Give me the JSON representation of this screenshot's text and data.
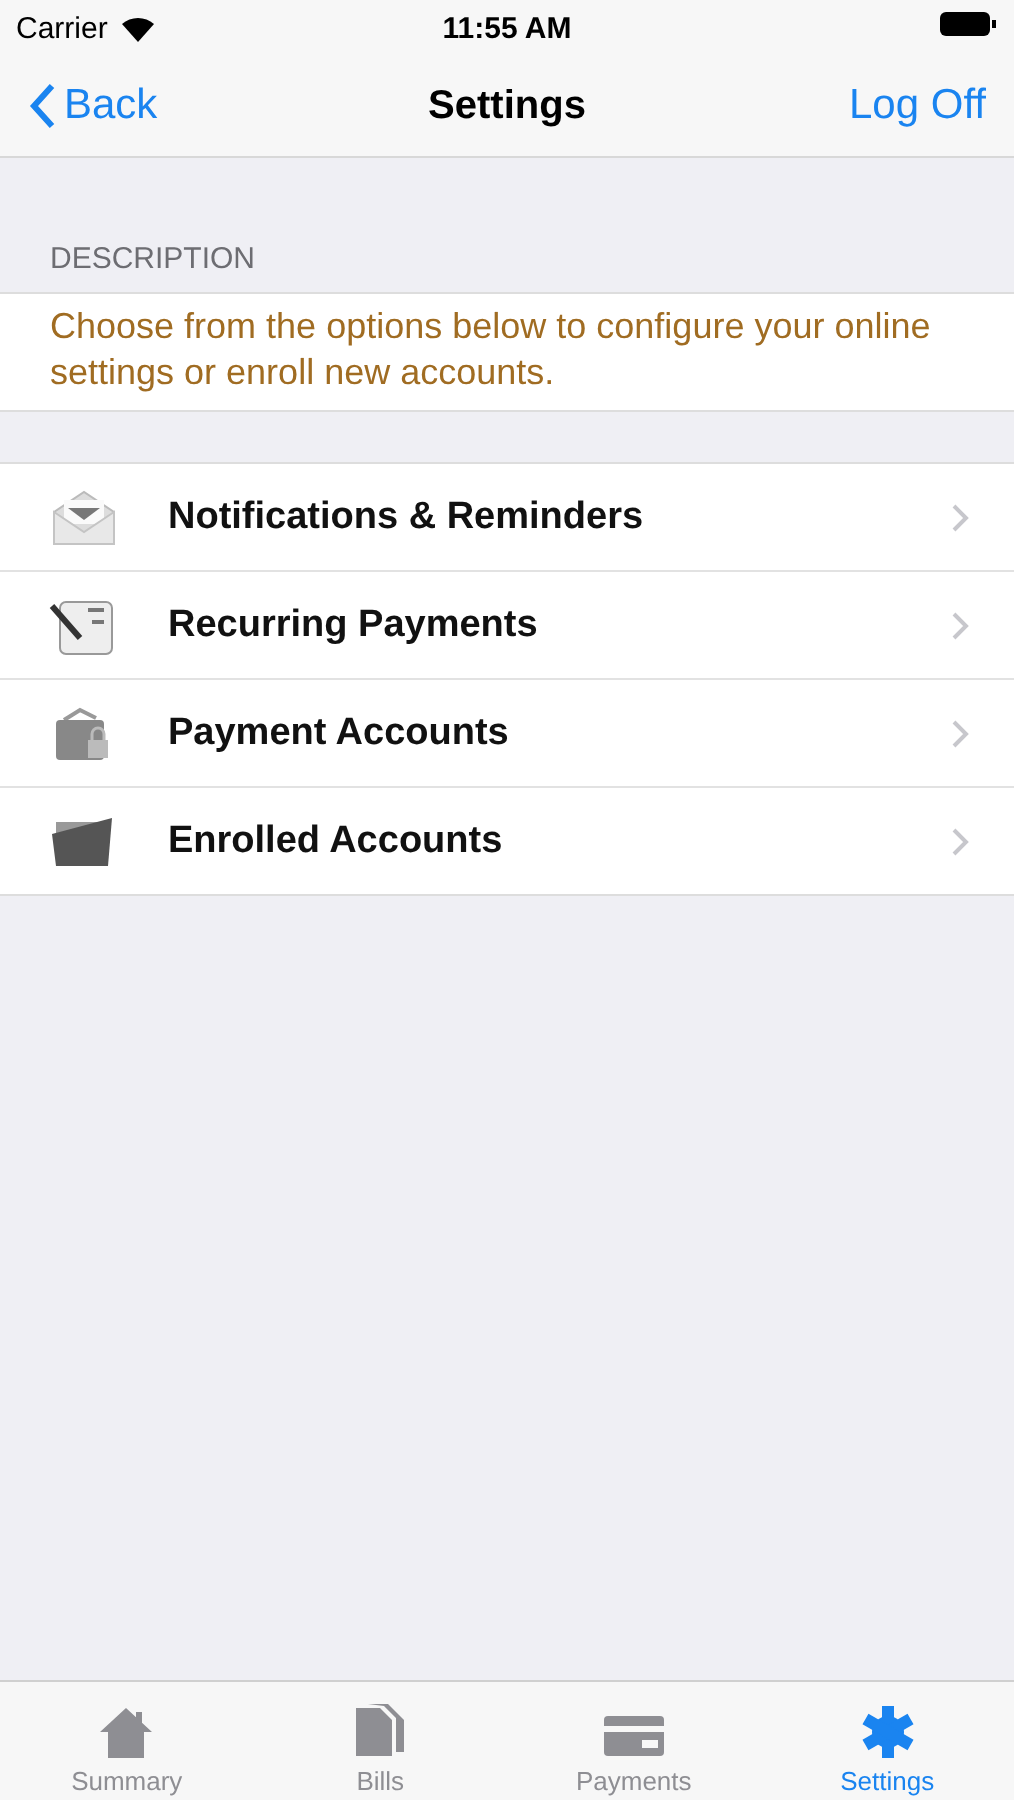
{
  "status_bar": {
    "carrier": "Carrier",
    "time": "11:55 AM"
  },
  "nav": {
    "back": "Back",
    "title": "Settings",
    "action": "Log Off"
  },
  "description": {
    "header": "DESCRIPTION",
    "text": "Choose from the options below to configure your online settings or enroll new accounts."
  },
  "items": [
    {
      "label": "Notifications & Reminders"
    },
    {
      "label": "Recurring Payments"
    },
    {
      "label": "Payment Accounts"
    },
    {
      "label": "Enrolled Accounts"
    }
  ],
  "tabs": [
    {
      "label": "Summary",
      "selected": false
    },
    {
      "label": "Bills",
      "selected": false
    },
    {
      "label": "Payments",
      "selected": false
    },
    {
      "label": "Settings",
      "selected": true
    }
  ]
}
